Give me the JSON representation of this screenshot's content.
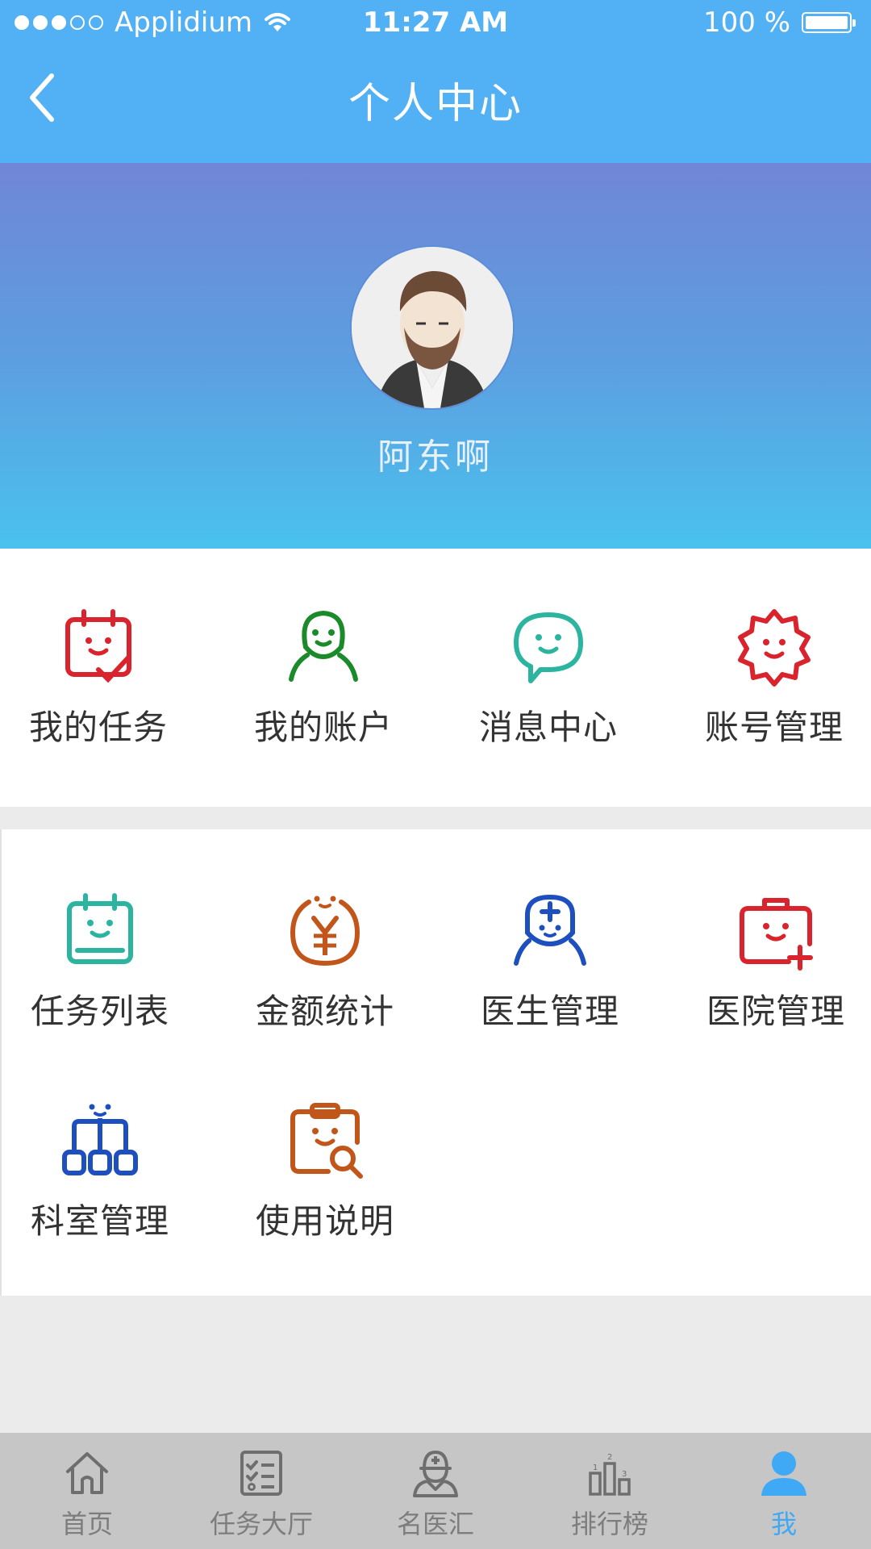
{
  "status_bar": {
    "carrier": "Applidium",
    "time": "11:27 AM",
    "battery": "100 %"
  },
  "nav": {
    "title": "个人中心"
  },
  "profile": {
    "username": "阿东啊"
  },
  "section1": [
    {
      "label": "我的任务",
      "icon": "task-calendar-icon",
      "color": "#d9232d"
    },
    {
      "label": "我的账户",
      "icon": "user-account-icon",
      "color": "#1a8a2a"
    },
    {
      "label": "消息中心",
      "icon": "chat-bubble-icon",
      "color": "#2bb5a0"
    },
    {
      "label": "账号管理",
      "icon": "gear-icon",
      "color": "#d9232d"
    }
  ],
  "section2": [
    {
      "label": "任务列表",
      "icon": "task-list-icon",
      "color": "#2bb5a0"
    },
    {
      "label": "金额统计",
      "icon": "yen-coin-icon",
      "color": "#c2561a"
    },
    {
      "label": "医生管理",
      "icon": "doctor-icon",
      "color": "#1d4fbf"
    },
    {
      "label": "医院管理",
      "icon": "medical-kit-icon",
      "color": "#d9232d"
    },
    {
      "label": "科室管理",
      "icon": "department-tree-icon",
      "color": "#1d4fbf"
    },
    {
      "label": "使用说明",
      "icon": "clipboard-search-icon",
      "color": "#c2561a"
    }
  ],
  "tabs": [
    {
      "label": "首页",
      "icon": "home-icon"
    },
    {
      "label": "任务大厅",
      "icon": "checklist-icon"
    },
    {
      "label": "名医汇",
      "icon": "doctor-icon"
    },
    {
      "label": "排行榜",
      "icon": "ranking-icon"
    },
    {
      "label": "我",
      "icon": "person-icon",
      "active": true
    }
  ],
  "colors": {
    "header": "#52b0f5",
    "tab_active": "#3fa9f5",
    "tab_inactive": "#7d7d7d"
  }
}
